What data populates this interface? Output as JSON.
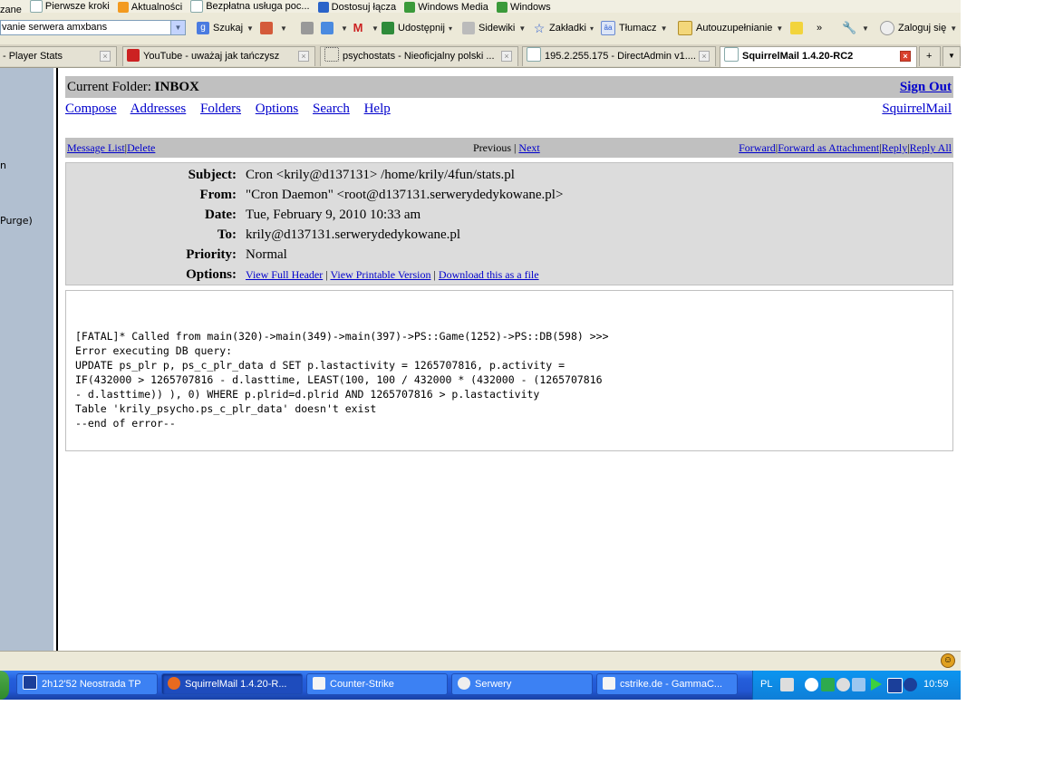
{
  "browser": {
    "bookmarks": [
      "zane",
      "Pierwsze kroki",
      "Aktualności",
      "Bezpłatna usługa poc...",
      "Dostosuj łącza",
      "Windows Media",
      "Windows"
    ],
    "address_value": "vanie serwera amxbans",
    "toolbar": {
      "search": "Szukaj",
      "share": "Udostępnij",
      "sidewiki": "Sidewiki",
      "bookmarks": "Zakładki",
      "translate": "Tłumacz",
      "autofill": "Autouzupełnianie",
      "more": "»",
      "login": "Zaloguj się"
    },
    "tabs": [
      "- Player Stats",
      "YouTube - uważaj jak tańczysz",
      "psychostats - Nieoficjalny polski ...",
      "195.2.255.175 - DirectAdmin v1....",
      "SquirrelMail 1.4.20-RC2"
    ],
    "new_tab": "+"
  },
  "sidebar": {
    "fragments": [
      "n",
      "Purge)"
    ]
  },
  "squirrelmail": {
    "current_folder_label": "Current Folder:",
    "current_folder": "INBOX",
    "sign_out": "Sign Out",
    "menu": [
      "Compose",
      "Addresses",
      "Folders",
      "Options",
      "Search",
      "Help"
    ],
    "brand": "SquirrelMail",
    "actions": {
      "message_list": "Message List",
      "delete": "Delete",
      "previous": "Previous",
      "next": "Next",
      "forward": "Forward",
      "forward_attachment": "Forward as Attachment",
      "reply": "Reply",
      "reply_all": "Reply All",
      "sep": "|"
    },
    "header": {
      "subject_label": "Subject:",
      "subject": "Cron <krily@d137131> /home/krily/4fun/stats.pl",
      "from_label": "From:",
      "from": "\"Cron Daemon\" <root@d137131.serwerydedykowane.pl>",
      "date_label": "Date:",
      "date": "Tue, February 9, 2010 10:33 am",
      "to_label": "To:",
      "to": "krily@d137131.serwerydedykowane.pl",
      "priority_label": "Priority:",
      "priority": "Normal",
      "options_label": "Options:",
      "view_full_header": "View Full Header",
      "view_printable": "View Printable Version",
      "download": "Download this as a file"
    },
    "body_text": "[FATAL]* Called from main(320)->main(349)->main(397)->PS::Game(1252)->PS::DB(598) >>>\nError executing DB query:\nUPDATE ps_plr p, ps_c_plr_data d SET p.lastactivity = 1265707816, p.activity =\nIF(432000 > 1265707816 - d.lasttime, LEAST(100, 100 / 432000 * (432000 - (1265707816\n- d.lasttime)) ), 0) WHERE p.plrid=d.plrid AND 1265707816 > p.lastactivity\nTable 'krily_psycho.ps_c_plr_data' doesn't exist\n--end of error--"
  },
  "taskbar": {
    "tasks": [
      "2h12'52 Neostrada TP",
      "SquirrelMail 1.4.20-R...",
      "Counter-Strike",
      "Serwery",
      "cstrike.de - GammaC..."
    ],
    "language": "PL",
    "clock": "10:59"
  }
}
